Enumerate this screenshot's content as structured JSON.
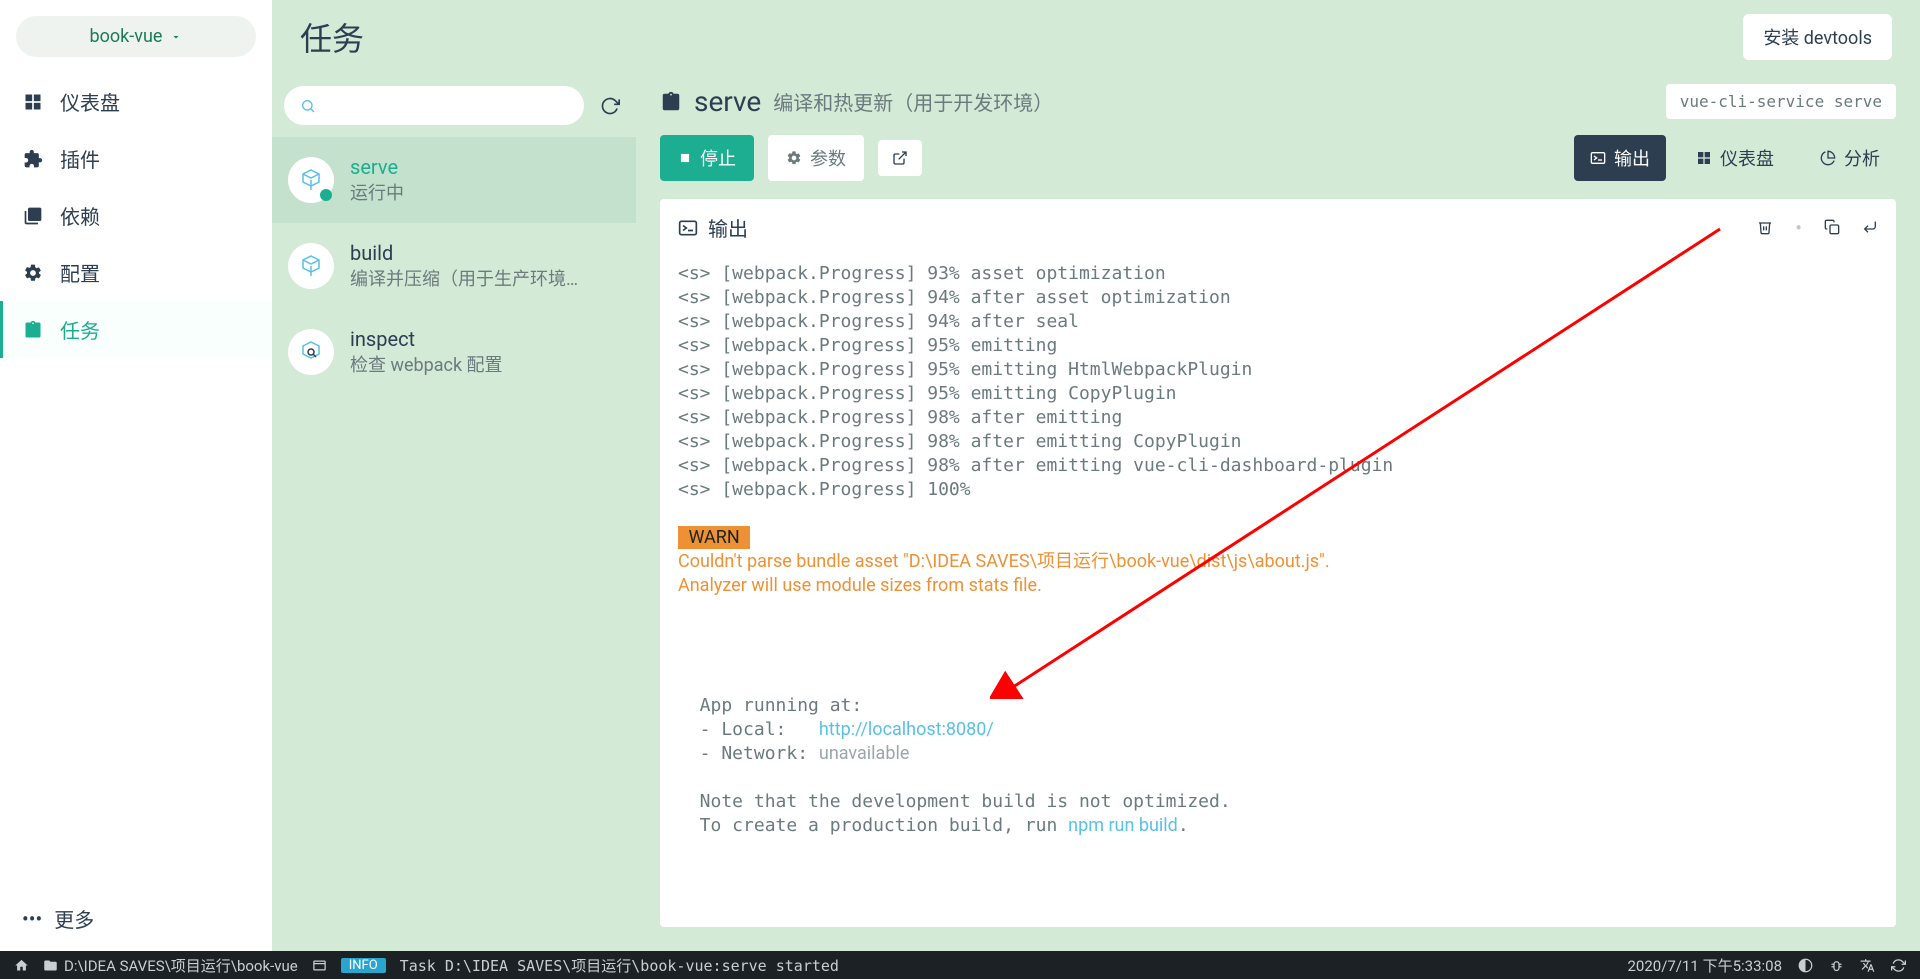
{
  "project": {
    "name": "book-vue"
  },
  "sidebar": {
    "items": [
      {
        "label": "仪表盘"
      },
      {
        "label": "插件"
      },
      {
        "label": "依赖"
      },
      {
        "label": "配置"
      },
      {
        "label": "任务"
      }
    ],
    "more": "更多"
  },
  "header": {
    "title": "任务",
    "install": "安装 devtools"
  },
  "tasks": {
    "search_placeholder": "",
    "items": [
      {
        "name": "serve",
        "desc": "运行中"
      },
      {
        "name": "build",
        "desc": "编译并压缩（用于生产环境…"
      },
      {
        "name": "inspect",
        "desc": "检查 webpack 配置"
      }
    ]
  },
  "detail": {
    "title": "serve",
    "subtitle": "编译和热更新（用于开发环境）",
    "command": "vue-cli-service serve",
    "stop": "停止",
    "params": "参数",
    "tabs": {
      "output": "输出",
      "dashboard": "仪表盘",
      "analyze": "分析"
    },
    "output_title": "输出",
    "terminal": {
      "progress": [
        "<s> [webpack.Progress] 93% asset optimization",
        "<s> [webpack.Progress] 94% after asset optimization",
        "<s> [webpack.Progress] 94% after seal",
        "<s> [webpack.Progress] 95% emitting",
        "<s> [webpack.Progress] 95% emitting HtmlWebpackPlugin",
        "<s> [webpack.Progress] 95% emitting CopyPlugin",
        "<s> [webpack.Progress] 98% after emitting",
        "<s> [webpack.Progress] 98% after emitting CopyPlugin",
        "<s> [webpack.Progress] 98% after emitting vue-cli-dashboard-plugin",
        "<s> [webpack.Progress] 100%"
      ],
      "warn_label": " WARN ",
      "warn_line1": "Couldn't parse bundle asset \"D:\\IDEA SAVES\\项目运行\\book-vue\\dist\\js\\about.js\".",
      "warn_line2": "Analyzer will use module sizes from stats file.",
      "app_running": "  App running at:",
      "local_label": "  - Local:   ",
      "local_url": "http://localhost:8080/",
      "network_label": "  - Network: ",
      "network_value": "unavailable",
      "note1": "  Note that the development build is not optimized.",
      "note2a": "  To create a production build, run ",
      "note2b": "npm run build",
      "note2c": "."
    }
  },
  "statusbar": {
    "path": "D:\\IDEA SAVES\\项目运行\\book-vue",
    "info": "INFO",
    "task": "Task D:\\IDEA SAVES\\项目运行\\book-vue:serve started",
    "datetime": "2020/7/11 下午5:33:08"
  }
}
